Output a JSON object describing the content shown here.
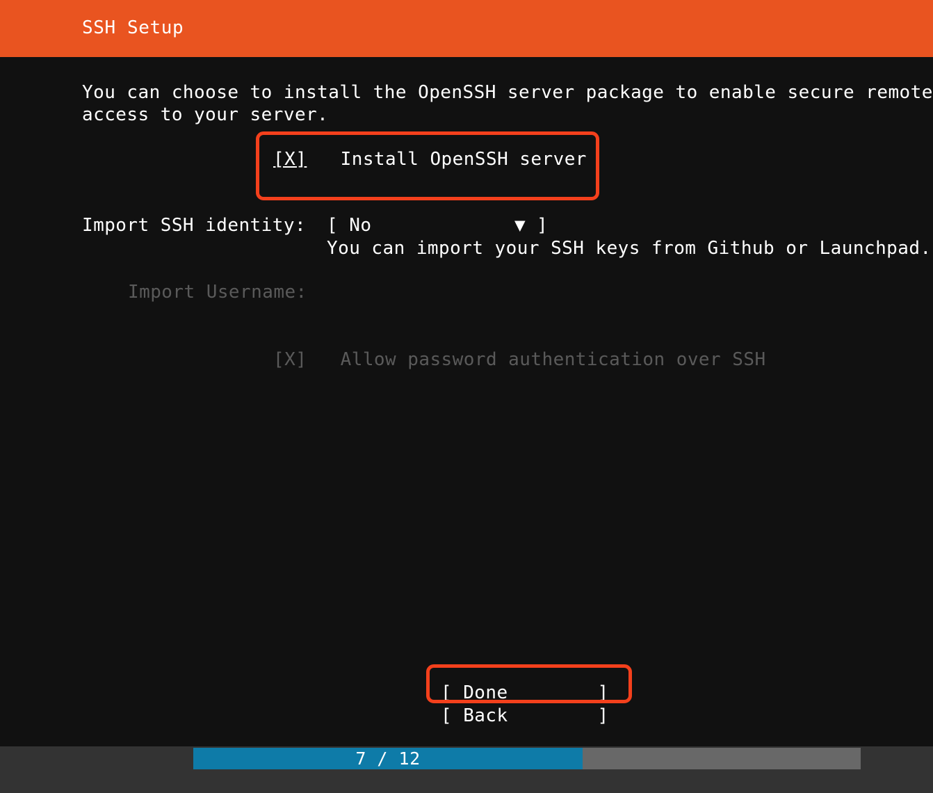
{
  "header": {
    "title": "SSH Setup",
    "background_color": "#e95420",
    "text_color": "#ffffff"
  },
  "body": {
    "background_color": "#111111",
    "description_line_1": "You can choose to install the OpenSSH server package to enable secure remote",
    "description_line_2": "access to your server."
  },
  "form": {
    "install_openssh": {
      "checkbox": "[X]",
      "checkbox_state": "checked",
      "label": "Install OpenSSH server",
      "highlighted": true
    },
    "import_identity": {
      "label": "Import SSH identity:",
      "open_bracket": "[",
      "value": "No",
      "arrow": "▼",
      "close_bracket": "]",
      "options": [
        "No"
      ],
      "hint": "You can import your SSH keys from Github or Launchpad."
    },
    "import_username": {
      "label": "Import Username:",
      "disabled": true
    },
    "allow_password_auth": {
      "checkbox": "[X]",
      "checkbox_state": "checked",
      "label": "Allow password authentication over SSH",
      "disabled": true
    }
  },
  "buttons": {
    "done": "[ Done        ]",
    "back": "[ Back        ]",
    "done_highlighted": true
  },
  "footer": {
    "progress_label": "7 / 12",
    "current_step": 7,
    "total_steps": 12,
    "fill_color": "#0e7ba8",
    "track_color": "#686868",
    "background_color": "#333333"
  },
  "annotations": {
    "highlight_color": "#f4401c"
  }
}
